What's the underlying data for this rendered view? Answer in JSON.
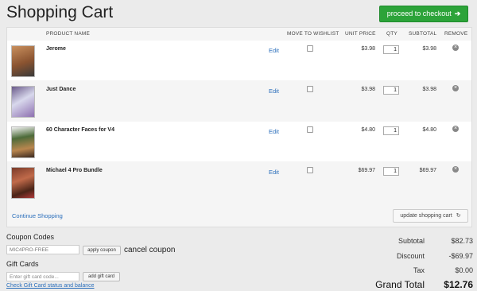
{
  "page": {
    "title": "Shopping Cart"
  },
  "header": {
    "checkout_label": "proceed to checkout",
    "checkout_arrow": "➔"
  },
  "table": {
    "columns": {
      "product_name": "PRODUCT NAME",
      "move_to_wishlist": "MOVE TO WISHLIST",
      "unit_price": "UNIT PRICE",
      "qty": "QTY",
      "subtotal": "SUBTOTAL",
      "remove": "REMOVE"
    },
    "edit_label": "Edit",
    "items": [
      {
        "name": "Jerome",
        "unit_price": "$3.98",
        "qty": "1",
        "subtotal": "$3.98"
      },
      {
        "name": "Just Dance",
        "unit_price": "$3.98",
        "qty": "1",
        "subtotal": "$3.98"
      },
      {
        "name": "60 Character Faces for V4",
        "unit_price": "$4.80",
        "qty": "1",
        "subtotal": "$4.80"
      },
      {
        "name": "Michael 4 Pro Bundle",
        "unit_price": "$69.97",
        "qty": "1",
        "subtotal": "$69.97"
      }
    ]
  },
  "footer": {
    "continue_label": "Continue Shopping",
    "update_label": "update shopping cart",
    "update_icon": "↻"
  },
  "coupon": {
    "heading": "Coupon Codes",
    "value": "MIC4PRO-FREE",
    "apply_label": "apply coupon",
    "cancel_label": "cancel coupon"
  },
  "gift": {
    "heading": "Gift Cards",
    "placeholder": "Enter gift card code...",
    "add_label": "add gift card",
    "check_link": "Check Gift Card status and balance"
  },
  "totals": {
    "subtotal_label": "Subtotal",
    "subtotal": "$82.73",
    "discount_label": "Discount",
    "discount": "-$69.97",
    "tax_label": "Tax",
    "tax": "$0.00",
    "grand_label": "Grand Total",
    "grand": "$12.76"
  }
}
